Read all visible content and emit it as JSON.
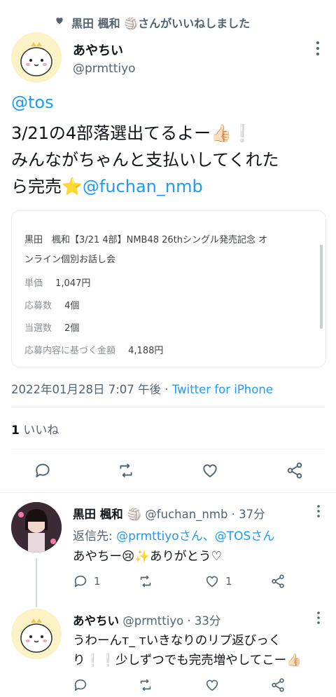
{
  "social_context": {
    "text": "黒田 楓和 🏐さんがいいねしました"
  },
  "tweet": {
    "author_name": "あやちい",
    "handle": "@prmttiyo",
    "mention_tos": "@tos",
    "line1": "3/21の4部落選出てるよー👍🏻❕",
    "line2": "みんながちゃんと支払いしてくれた",
    "line3_prefix": "ら完売⭐",
    "mention_fuchan": "@fuchan_nmb",
    "card": {
      "title_line1": "黒田　楓和【3/21 4部】NMB48 26thシングル発売記念 オ",
      "title_line2": "ンライン個別お話し会",
      "rows": [
        {
          "label": "単価",
          "value": "1,047円"
        },
        {
          "label": "応募数",
          "value": "4個"
        },
        {
          "label": "当選数",
          "value": "2個"
        },
        {
          "label": "応募内容に基づく金額",
          "value": "4,188円"
        }
      ]
    },
    "timestamp": "2022年01月28日 7:07 午後",
    "separator": " · ",
    "client": "Twitter for iPhone",
    "like_count": "1",
    "like_label": "いいね"
  },
  "reply1": {
    "name": "黒田 楓和 🏐",
    "handle_time": "@fuchan_nmb · 37分",
    "replying_prefix": "返信先: ",
    "replying_targets": "@prmttiyoさん、@TOSさん",
    "text": "あやちー😢✨ありがとう♡",
    "reply_count": "1",
    "like_count": "1"
  },
  "reply2": {
    "name": "あやちい",
    "handle_time": "@prmttiyo · 33分",
    "line1": "うわーんт_ тいきなりのリプ返びっく",
    "line2": "り❕❕少しずつでも完売増やしてこー👍🏻"
  },
  "colors": {
    "accent": "#1d9bf0",
    "muted": "#536471",
    "text": "#0f1419"
  },
  "icons": [
    "heart-icon",
    "more-icon",
    "reply-icon",
    "retweet-icon",
    "like-icon",
    "share-icon"
  ]
}
